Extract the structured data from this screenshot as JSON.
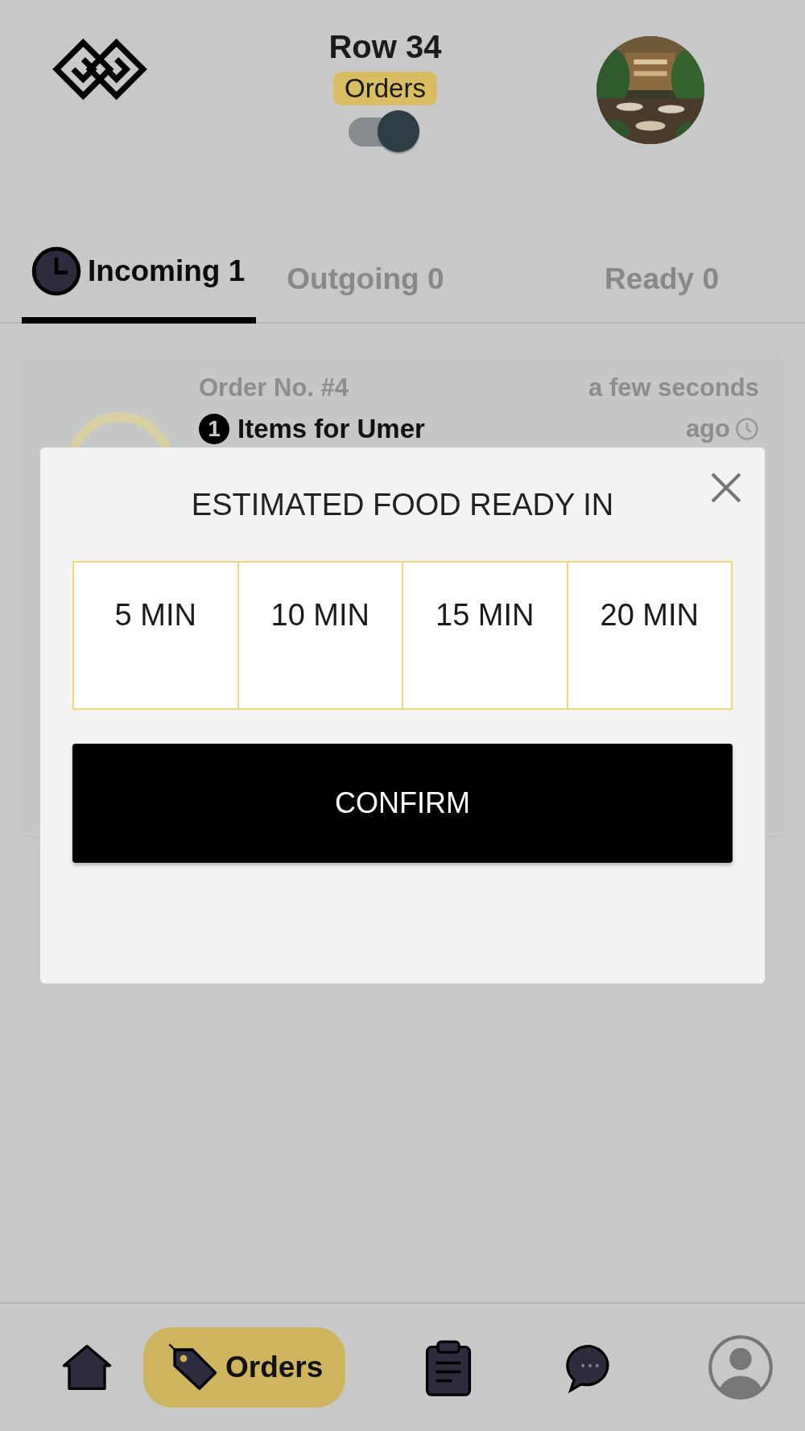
{
  "header": {
    "title": "Row 34",
    "badge": "Orders",
    "toggle_on": true
  },
  "tabs": [
    {
      "label": "Incoming 1",
      "selected": true,
      "icon": true
    },
    {
      "label": "Outgoing 0",
      "selected": false,
      "icon": false
    },
    {
      "label": "Ready 0",
      "selected": false,
      "icon": false
    }
  ],
  "order_card": {
    "number": "Order No. #4",
    "time": "a few seconds",
    "time_2": "ago",
    "count": "1",
    "title": "Items for Umer"
  },
  "modal": {
    "title": "ESTIMATED FOOD READY IN",
    "options": [
      {
        "label": "5 MIN",
        "selected": false
      },
      {
        "label": "10 MIN",
        "selected": false
      },
      {
        "label": "15 MIN",
        "selected": false
      },
      {
        "label": "20 MIN",
        "selected": false
      }
    ],
    "confirm": "CONFIRM"
  },
  "bottom_nav": [
    {
      "kind": "home",
      "selected": false
    },
    {
      "kind": "orders",
      "label": "Orders",
      "selected": true
    },
    {
      "kind": "clipboard",
      "selected": false
    },
    {
      "kind": "chat",
      "selected": false
    },
    {
      "kind": "profile",
      "selected": false
    }
  ]
}
